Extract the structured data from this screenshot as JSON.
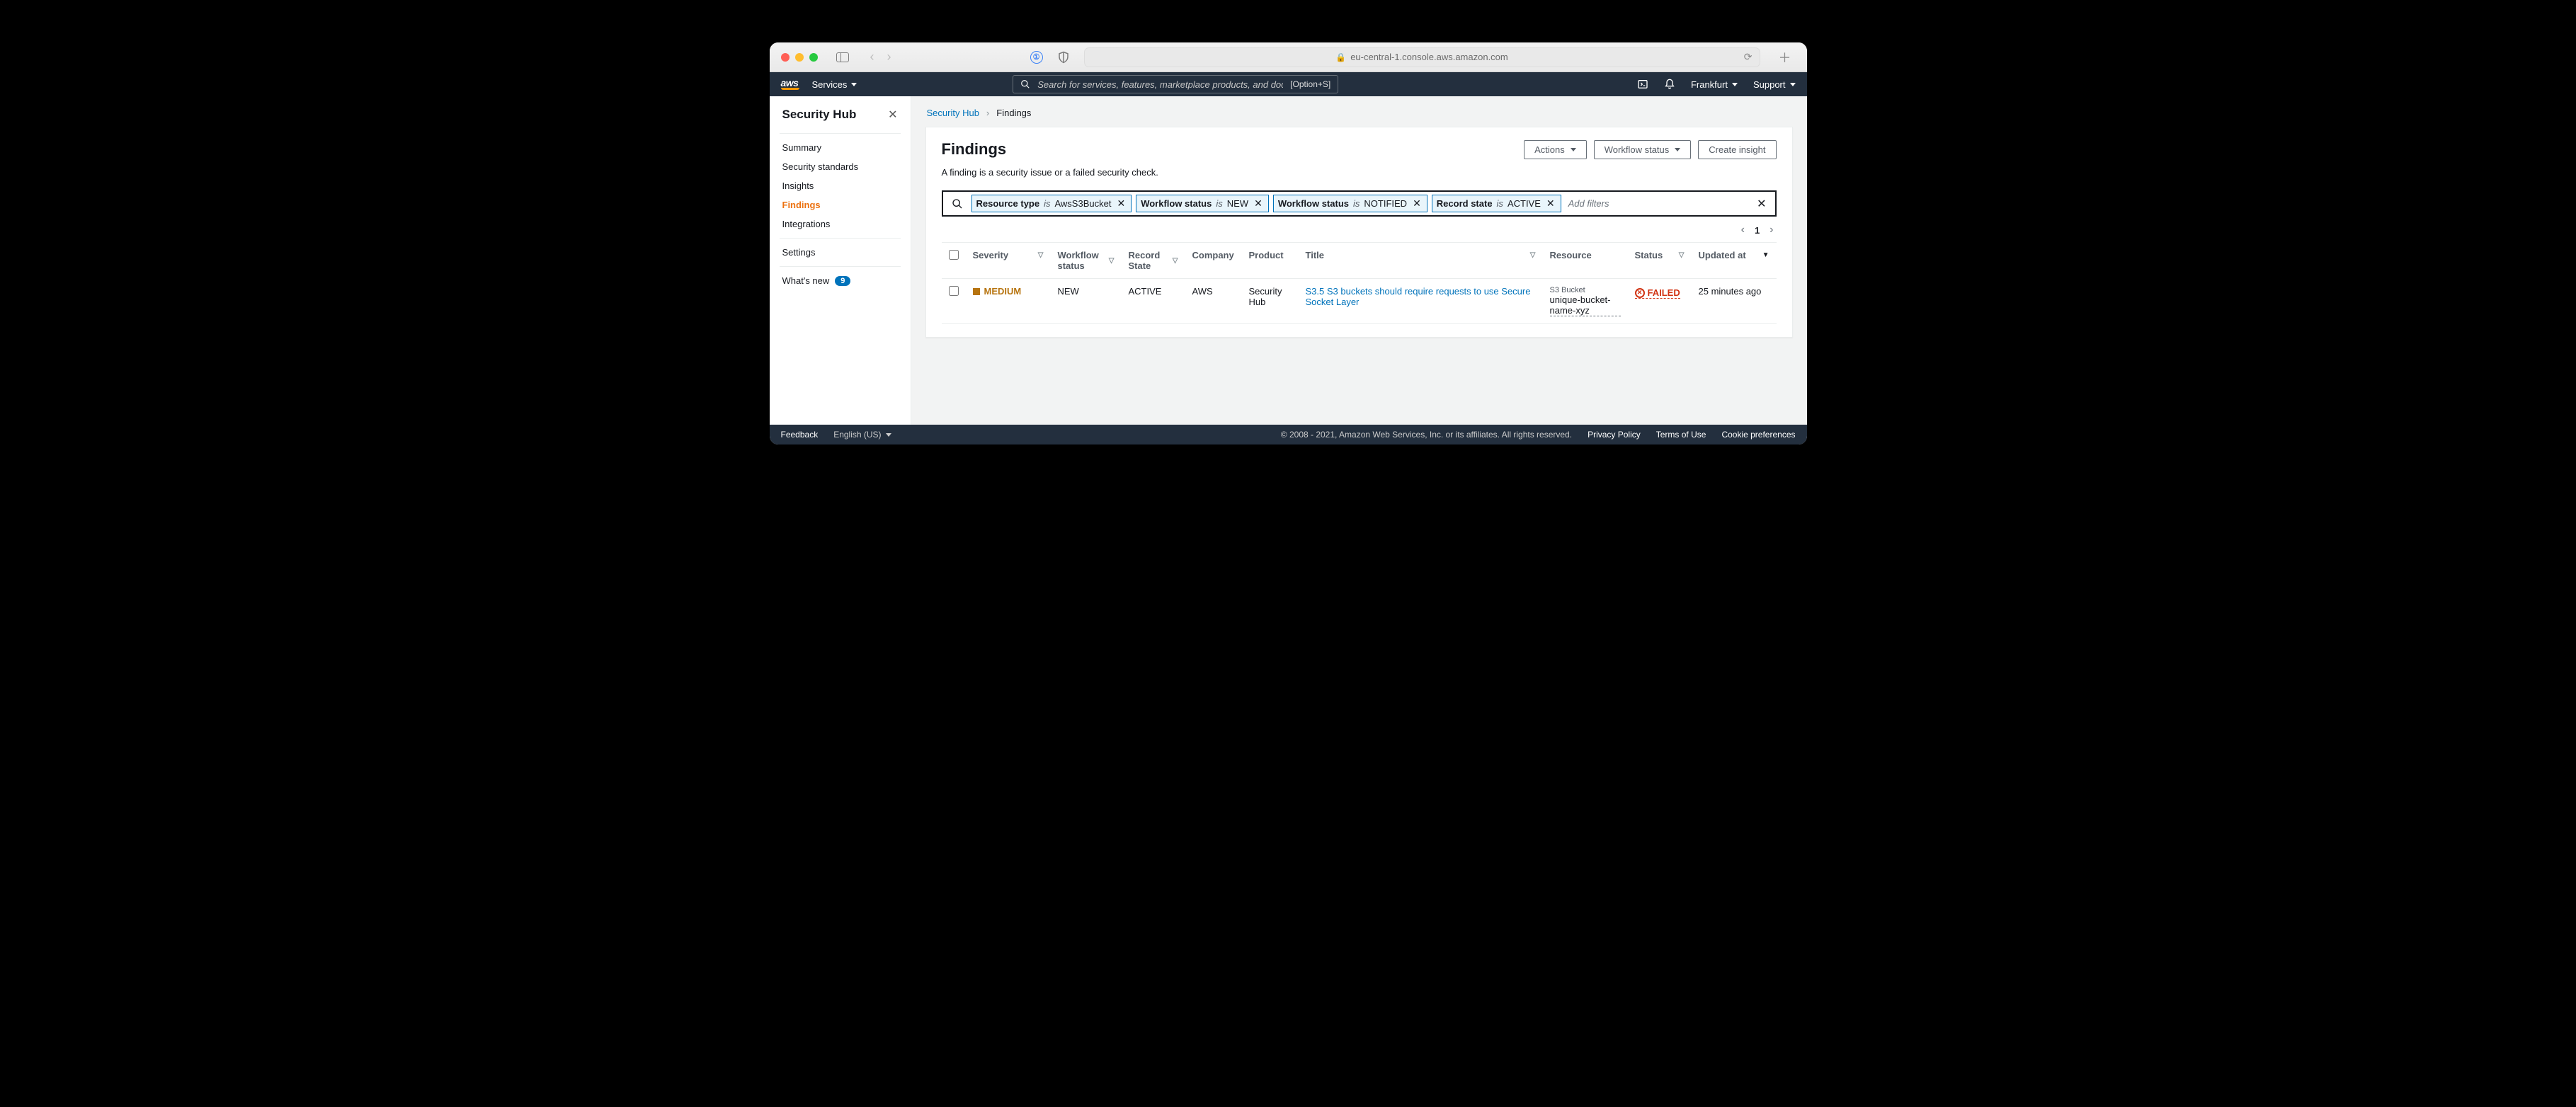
{
  "browser": {
    "url": "eu-central-1.console.aws.amazon.com"
  },
  "aws_top": {
    "services": "Services",
    "search_placeholder": "Search for services, features, marketplace products, and docs",
    "search_shortcut": "[Option+S]",
    "region": "Frankfurt",
    "support": "Support"
  },
  "sidebar": {
    "title": "Security Hub",
    "items": [
      {
        "label": "Summary"
      },
      {
        "label": "Security standards"
      },
      {
        "label": "Insights"
      },
      {
        "label": "Findings",
        "active": true
      },
      {
        "label": "Integrations"
      }
    ],
    "settings": "Settings",
    "whatsnew": "What's new",
    "whatsnew_count": "9"
  },
  "breadcrumb": {
    "root": "Security Hub",
    "current": "Findings"
  },
  "panel": {
    "heading": "Findings",
    "sub": "A finding is a security issue or a failed security check.",
    "actions_btn": "Actions",
    "workflow_btn": "Workflow status",
    "create_btn": "Create insight"
  },
  "filters": {
    "chips": [
      {
        "field": "Resource type",
        "op": "is",
        "value": "AwsS3Bucket"
      },
      {
        "field": "Workflow status",
        "op": "is",
        "value": "NEW"
      },
      {
        "field": "Workflow status",
        "op": "is",
        "value": "NOTIFIED"
      },
      {
        "field": "Record state",
        "op": "is",
        "value": "ACTIVE"
      }
    ],
    "add_placeholder": "Add filters"
  },
  "pager": {
    "page": "1"
  },
  "columns": {
    "severity": "Severity",
    "workflow": "Workflow status",
    "record": "Record State",
    "company": "Company",
    "product": "Product",
    "title": "Title",
    "resource": "Resource",
    "status": "Status",
    "updated": "Updated at"
  },
  "rows": [
    {
      "severity": "MEDIUM",
      "workflow": "NEW",
      "record": "ACTIVE",
      "company": "AWS",
      "product": "Security Hub",
      "title": "S3.5 S3 buckets should require requests to use Secure Socket Layer",
      "resource_type": "S3 Bucket",
      "resource_name": "unique-bucket-name-xyz",
      "status": "FAILED",
      "updated": "25 minutes ago"
    }
  ],
  "footer": {
    "feedback": "Feedback",
    "language": "English (US)",
    "copyright": "© 2008 - 2021, Amazon Web Services, Inc. or its affiliates. All rights reserved.",
    "privacy": "Privacy Policy",
    "terms": "Terms of Use",
    "cookies": "Cookie preferences"
  }
}
